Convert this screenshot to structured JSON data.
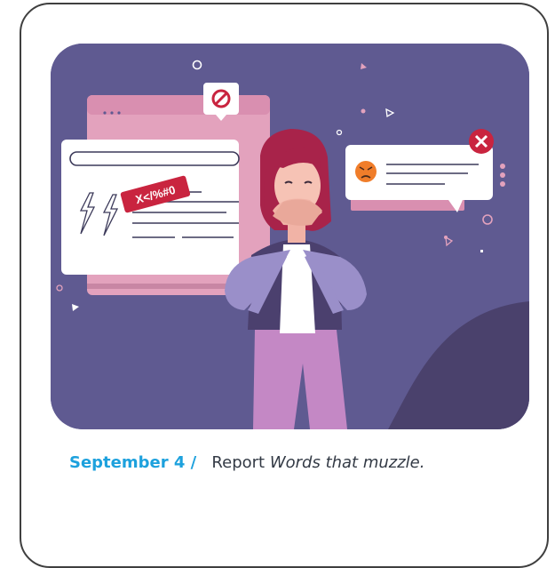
{
  "post": {
    "date_label": "September 4 /",
    "type_label": "Report",
    "title": "Words that muzzle."
  },
  "illustration": {
    "censored_text": "X</%#0",
    "icons": [
      "prohibited-icon",
      "close-icon",
      "angry-face-icon",
      "lightning-icon"
    ],
    "colors": {
      "background": "#5f5a91",
      "window_pink": "#e3a2bd",
      "badge_red": "#c9243f",
      "accent_blue": "#1da1dd"
    }
  }
}
